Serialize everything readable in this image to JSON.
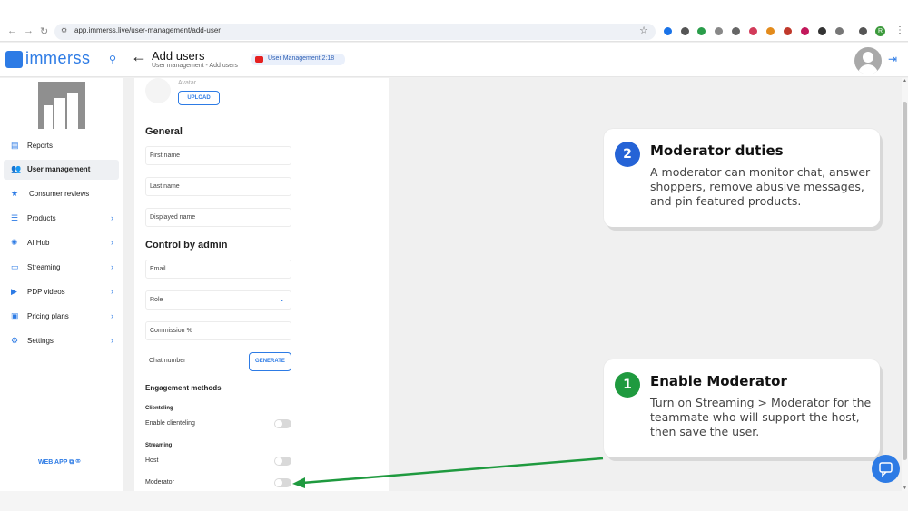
{
  "browser": {
    "url": "app.immerss.live/user-management/add-user",
    "profile_initial": "R"
  },
  "header": {
    "logo": "immerss",
    "title": "Add users",
    "breadcrumb": "User management - Add users",
    "video_pill": "User Management 2:18"
  },
  "sidebar": {
    "items": [
      {
        "label": "Reports",
        "icon": "report-icon",
        "chevron": false,
        "active": false
      },
      {
        "label": "User management",
        "icon": "users-icon",
        "chevron": false,
        "active": true
      },
      {
        "label": "Consumer reviews",
        "icon": "star-icon",
        "chevron": false,
        "active": false
      },
      {
        "label": "Products",
        "icon": "list-icon",
        "chevron": true,
        "active": false
      },
      {
        "label": "AI Hub",
        "icon": "ai-icon",
        "chevron": true,
        "active": false
      },
      {
        "label": "Streaming",
        "icon": "monitor-icon",
        "chevron": true,
        "active": false
      },
      {
        "label": "PDP videos",
        "icon": "video-icon",
        "chevron": true,
        "active": false
      },
      {
        "label": "Pricing plans",
        "icon": "pricing-icon",
        "chevron": true,
        "active": false
      },
      {
        "label": "Settings",
        "icon": "gear-icon",
        "chevron": true,
        "active": false
      }
    ],
    "web_app": "WEB APP"
  },
  "form": {
    "avatar_caption": "Avatar",
    "upload": "UPLOAD",
    "general_heading": "General",
    "first_name": "First name",
    "last_name": "Last name",
    "displayed_name": "Displayed name",
    "control_heading": "Control by admin",
    "email": "Email",
    "role": "Role",
    "commission": "Commission %",
    "chat_number": "Chat number",
    "generate": "GENERATE",
    "engagement_heading": "Engagement methods",
    "clienteling_heading": "Clienteling",
    "enable_clienteling": "Enable clienteling",
    "streaming_heading": "Streaming",
    "host": "Host",
    "moderator": "Moderator"
  },
  "callouts": {
    "card2": {
      "number": "2",
      "title": "Moderator duties",
      "body": "A moderator can monitor chat, answer shoppers, remove abusive messages, and pin featured products.",
      "badge_color": "#2563d6"
    },
    "card1": {
      "number": "1",
      "title": "Enable Moderator",
      "body": "Turn on Streaming > Moderator for the teammate who will support the host, then save the user.",
      "badge_color": "#1f9a3f"
    }
  },
  "colors": {
    "accent": "#2d7be5",
    "arrow": "#1f9a3f"
  }
}
